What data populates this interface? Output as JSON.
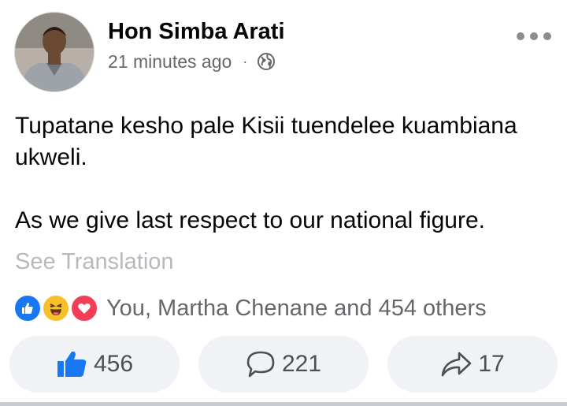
{
  "post": {
    "author": {
      "name": "Hon Simba Arati",
      "avatar_icon": "profile-photo"
    },
    "timestamp": "21 minutes ago",
    "separator": "·",
    "privacy_icon": "globe-icon",
    "more_icon": "more-horizontal-icon",
    "body": {
      "paragraph_1": "Tupatane kesho pale Kisii tuendelee kuambiana ukweli.",
      "paragraph_2": "As we give last respect to our national figure."
    },
    "see_translation": "See Translation",
    "reactions": {
      "icons": [
        "like-icon",
        "haha-icon",
        "love-icon"
      ],
      "summary": "You, Martha Chenane and 454 others"
    },
    "actions": {
      "like": {
        "icon": "thumbs-up-icon",
        "count": "456"
      },
      "comment": {
        "icon": "comment-icon",
        "count": "221"
      },
      "share": {
        "icon": "share-icon",
        "count": "17"
      }
    }
  },
  "colors": {
    "like_blue": "#1877f2",
    "haha_yellow": "#f7c02b",
    "love_red": "#f33e58",
    "muted_text": "#65676b",
    "button_bg": "#f0f2f5"
  }
}
